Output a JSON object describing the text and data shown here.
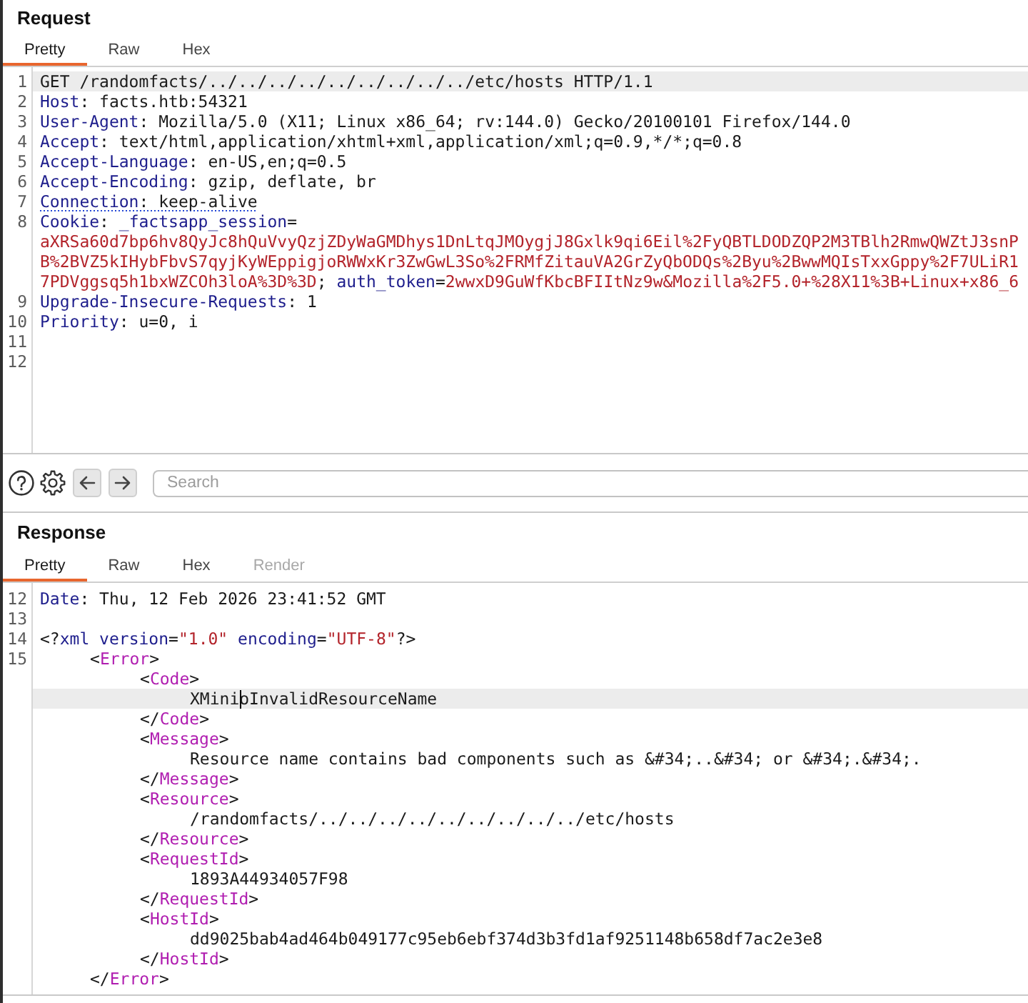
{
  "request": {
    "title": "Request",
    "tabs": [
      {
        "label": "Pretty",
        "selected": true,
        "disabled": false
      },
      {
        "label": "Raw",
        "selected": false,
        "disabled": false
      },
      {
        "label": "Hex",
        "selected": false,
        "disabled": false
      }
    ],
    "lines": [
      {
        "number": "1",
        "underlined": false,
        "rows": [
          {
            "current": true,
            "segments": [
              {
                "kind": "plain",
                "text": "GET /randomfacts/../../../../../../../../../etc/hosts HTTP/1.1"
              }
            ]
          }
        ]
      },
      {
        "number": "2",
        "underlined": false,
        "rows": [
          {
            "current": false,
            "segments": [
              {
                "kind": "key",
                "text": "Host"
              },
              {
                "kind": "plain",
                "text": ": facts.htb:54321"
              }
            ]
          }
        ]
      },
      {
        "number": "3",
        "underlined": false,
        "rows": [
          {
            "current": false,
            "segments": [
              {
                "kind": "key",
                "text": "User-Agent"
              },
              {
                "kind": "plain",
                "text": ": Mozilla/5.0 (X11; Linux x86_64; rv:144.0) Gecko/20100101 Firefox/144.0"
              }
            ]
          }
        ]
      },
      {
        "number": "4",
        "underlined": false,
        "rows": [
          {
            "current": false,
            "segments": [
              {
                "kind": "key",
                "text": "Accept"
              },
              {
                "kind": "plain",
                "text": ": text/html,application/xhtml+xml,application/xml;q=0.9,*/*;q=0.8"
              }
            ]
          }
        ]
      },
      {
        "number": "5",
        "underlined": false,
        "rows": [
          {
            "current": false,
            "segments": [
              {
                "kind": "key",
                "text": "Accept-Language"
              },
              {
                "kind": "plain",
                "text": ": en-US,en;q=0.5"
              }
            ]
          }
        ]
      },
      {
        "number": "6",
        "underlined": false,
        "rows": [
          {
            "current": false,
            "segments": [
              {
                "kind": "key",
                "text": "Accept-Encoding"
              },
              {
                "kind": "plain",
                "text": ": gzip, deflate, br"
              }
            ]
          }
        ]
      },
      {
        "number": "7",
        "underlined": true,
        "rows": [
          {
            "current": false,
            "segments": [
              {
                "kind": "key",
                "text": "Connection"
              },
              {
                "kind": "plain",
                "text": ": keep-alive"
              }
            ]
          }
        ]
      },
      {
        "number": "8",
        "underlined": false,
        "rows": [
          {
            "current": false,
            "segments": [
              {
                "kind": "key",
                "text": "Cookie"
              },
              {
                "kind": "plain",
                "text": ": "
              },
              {
                "kind": "key",
                "text": "_factsapp_session"
              },
              {
                "kind": "plain",
                "text": "="
              }
            ]
          },
          {
            "current": false,
            "segments": [
              {
                "kind": "value",
                "text": "aXRSa60d7bp6hv8QyJc8hQuVvyQzjZDyWaGMDhys1DnLtqJMOygjJ8Gxlk9qi6Eil%2FyQBTLDODZQP2M3TBlh2RmwQWZtJ3snP"
              }
            ]
          },
          {
            "current": false,
            "segments": [
              {
                "kind": "value",
                "text": "B%2BVZ5kIHybFbvS7qyjKyWEppigjoRWWxKr3ZwGwL3So%2FRMfZitauVA2GrZyQbODQs%2Byu%2BwwMQIsTxxGppy%2F7ULiR1"
              }
            ]
          },
          {
            "current": false,
            "segments": [
              {
                "kind": "value",
                "text": "7PDVggsq5h1bxWZCOh3loA%3D%3D"
              },
              {
                "kind": "plain",
                "text": "; "
              },
              {
                "kind": "key",
                "text": "auth_token"
              },
              {
                "kind": "plain",
                "text": "="
              },
              {
                "kind": "value",
                "text": "2wwxD9GuWfKbcBFIItNz9w&Mozilla%2F5.0+%28X11%3B+Linux+x86_6"
              }
            ]
          }
        ]
      },
      {
        "number": "9",
        "underlined": false,
        "rows": [
          {
            "current": false,
            "segments": [
              {
                "kind": "key",
                "text": "Upgrade-Insecure-Requests"
              },
              {
                "kind": "plain",
                "text": ": 1"
              }
            ]
          }
        ]
      },
      {
        "number": "10",
        "underlined": false,
        "rows": [
          {
            "current": false,
            "segments": [
              {
                "kind": "key",
                "text": "Priority"
              },
              {
                "kind": "plain",
                "text": ": u=0, i"
              }
            ]
          }
        ]
      },
      {
        "number": "11"
      },
      {
        "number": "12"
      }
    ]
  },
  "toolbar": {
    "search": {
      "placeholder": "Search"
    }
  },
  "response": {
    "title": "Response",
    "tabs": [
      {
        "label": "Pretty",
        "selected": true,
        "disabled": false
      },
      {
        "label": "Raw",
        "selected": false,
        "disabled": false
      },
      {
        "label": "Hex",
        "selected": false,
        "disabled": false
      },
      {
        "label": "Render",
        "selected": false,
        "disabled": true
      }
    ],
    "lines": [
      {
        "number": "12",
        "underlined": false,
        "rows": [
          {
            "current": false,
            "segments": [
              {
                "kind": "key",
                "text": "Date"
              },
              {
                "kind": "plain",
                "text": ": Thu, 12 Feb 2026 23:41:52 GMT"
              }
            ]
          }
        ]
      },
      {
        "number": "13"
      },
      {
        "number": "14",
        "underlined": false,
        "rows": [
          {
            "current": false,
            "segments": [
              {
                "kind": "plain",
                "text": "<?"
              },
              {
                "kind": "key",
                "text": "xml version"
              },
              {
                "kind": "plain",
                "text": "="
              },
              {
                "kind": "value",
                "text": "\"1.0\""
              },
              {
                "kind": "key",
                "text": " encoding"
              },
              {
                "kind": "plain",
                "text": "="
              },
              {
                "kind": "value",
                "text": "\"UTF-8\""
              },
              {
                "kind": "plain",
                "text": "?>"
              }
            ]
          }
        ]
      },
      {
        "number": "15",
        "underlined": false,
        "tree": [
          {
            "open": {
              "segments": [
                {
                  "kind": "plain",
                  "text": "<"
                },
                {
                  "kind": "tag",
                  "text": "Error"
                },
                {
                  "kind": "plain",
                  "text": ">"
                }
              ]
            },
            "children": [
              {
                "open": {
                  "segments": [
                    {
                      "kind": "plain",
                      "text": "<"
                    },
                    {
                      "kind": "tag",
                      "text": "Code"
                    },
                    {
                      "kind": "plain",
                      "text": ">"
                    }
                  ]
                },
                "children": [
                  {
                    "current": true,
                    "segments": [
                      {
                        "kind": "plain",
                        "text": "XMini"
                      },
                      {
                        "kind": "caret"
                      },
                      {
                        "kind": "plain",
                        "text": "oInvalidResourceName"
                      }
                    ]
                  }
                ],
                "close": {
                  "segments": [
                    {
                      "kind": "plain",
                      "text": "</"
                    },
                    {
                      "kind": "tag",
                      "text": "Code"
                    },
                    {
                      "kind": "plain",
                      "text": ">"
                    }
                  ]
                }
              },
              {
                "open": {
                  "segments": [
                    {
                      "kind": "plain",
                      "text": "<"
                    },
                    {
                      "kind": "tag",
                      "text": "Message"
                    },
                    {
                      "kind": "plain",
                      "text": ">"
                    }
                  ]
                },
                "children": [
                  {
                    "current": false,
                    "segments": [
                      {
                        "kind": "plain",
                        "text": "Resource name contains bad components such as &#34;..&#34; or &#34;.&#34;."
                      }
                    ]
                  }
                ],
                "close": {
                  "segments": [
                    {
                      "kind": "plain",
                      "text": "</"
                    },
                    {
                      "kind": "tag",
                      "text": "Message"
                    },
                    {
                      "kind": "plain",
                      "text": ">"
                    }
                  ]
                }
              },
              {
                "open": {
                  "segments": [
                    {
                      "kind": "plain",
                      "text": "<"
                    },
                    {
                      "kind": "tag",
                      "text": "Resource"
                    },
                    {
                      "kind": "plain",
                      "text": ">"
                    }
                  ]
                },
                "children": [
                  {
                    "current": false,
                    "segments": [
                      {
                        "kind": "plain",
                        "text": "/randomfacts/../../../../../../../../../etc/hosts"
                      }
                    ]
                  }
                ],
                "close": {
                  "segments": [
                    {
                      "kind": "plain",
                      "text": "</"
                    },
                    {
                      "kind": "tag",
                      "text": "Resource"
                    },
                    {
                      "kind": "plain",
                      "text": ">"
                    }
                  ]
                }
              },
              {
                "open": {
                  "segments": [
                    {
                      "kind": "plain",
                      "text": "<"
                    },
                    {
                      "kind": "tag",
                      "text": "RequestId"
                    },
                    {
                      "kind": "plain",
                      "text": ">"
                    }
                  ]
                },
                "children": [
                  {
                    "current": false,
                    "segments": [
                      {
                        "kind": "plain",
                        "text": "1893A44934057F98"
                      }
                    ]
                  }
                ],
                "close": {
                  "segments": [
                    {
                      "kind": "plain",
                      "text": "</"
                    },
                    {
                      "kind": "tag",
                      "text": "RequestId"
                    },
                    {
                      "kind": "plain",
                      "text": ">"
                    }
                  ]
                }
              },
              {
                "open": {
                  "segments": [
                    {
                      "kind": "plain",
                      "text": "<"
                    },
                    {
                      "kind": "tag",
                      "text": "HostId"
                    },
                    {
                      "kind": "plain",
                      "text": ">"
                    }
                  ]
                },
                "children": [
                  {
                    "current": false,
                    "segments": [
                      {
                        "kind": "plain",
                        "text": "dd9025bab4ad464b049177c95eb6ebf374d3b3fd1af9251148b658df7ac2e3e8"
                      }
                    ]
                  }
                ],
                "close": {
                  "segments": [
                    {
                      "kind": "plain",
                      "text": "</"
                    },
                    {
                      "kind": "tag",
                      "text": "HostId"
                    },
                    {
                      "kind": "plain",
                      "text": ">"
                    }
                  ]
                }
              }
            ],
            "close": {
              "segments": [
                {
                  "kind": "plain",
                  "text": "</"
                },
                {
                  "kind": "tag",
                  "text": "Error"
                },
                {
                  "kind": "plain",
                  "text": ">"
                }
              ]
            }
          }
        ]
      }
    ]
  }
}
